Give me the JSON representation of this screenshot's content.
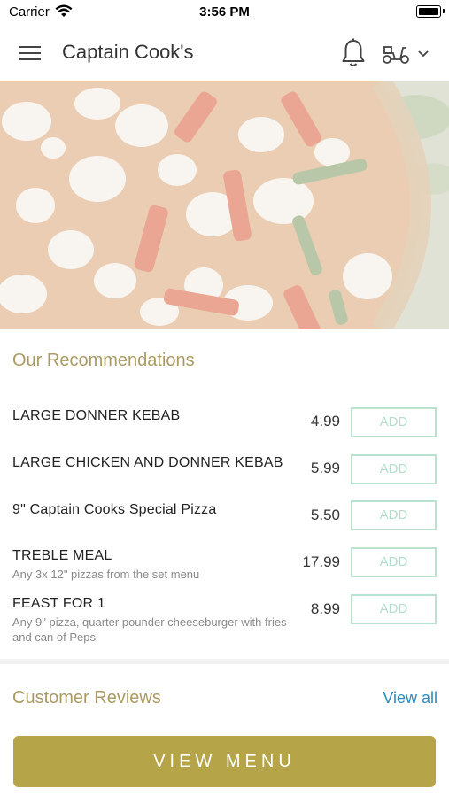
{
  "status_bar": {
    "carrier": "Carrier",
    "time": "3:56 PM"
  },
  "header": {
    "title": "Captain Cook's"
  },
  "recommendations": {
    "title": "Our Recommendations",
    "add_label": "ADD",
    "items": [
      {
        "name": "LARGE DONNER KEBAB",
        "price": "4.99",
        "description": ""
      },
      {
        "name": "LARGE CHICKEN AND DONNER KEBAB",
        "price": "5.99",
        "description": ""
      },
      {
        "name": "9\" Captain Cooks Special Pizza",
        "price": "5.50",
        "description": ""
      },
      {
        "name": "TREBLE MEAL",
        "price": "17.99",
        "description": "Any 3x 12\" pizzas from the set menu"
      },
      {
        "name": "FEAST FOR 1",
        "price": "8.99",
        "description": "Any 9\" pizza, quarter pounder cheeseburger with fries and can of Pepsi"
      }
    ]
  },
  "reviews": {
    "title": "Customer Reviews",
    "view_all": "View all"
  },
  "footer": {
    "view_menu": "VIEW MENU"
  },
  "colors": {
    "accent": "#b5a448",
    "section_title": "#a99b63",
    "add_border": "#b9e3cf",
    "link": "#2a8bc4"
  },
  "icons": [
    "menu-icon",
    "bell-icon",
    "scooter-icon",
    "chevron-down-icon",
    "wifi-icon",
    "battery-icon"
  ]
}
